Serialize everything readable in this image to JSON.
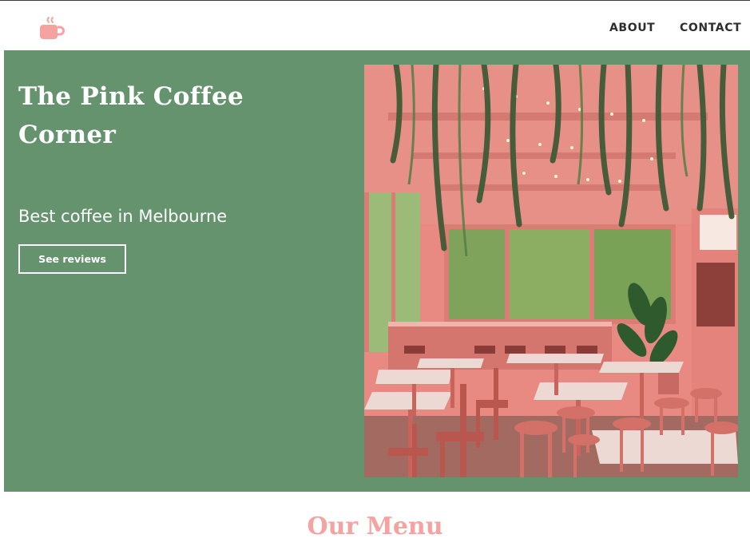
{
  "nav": {
    "logo_icon": "coffee-cup-icon",
    "about_label": "ABOUT",
    "contact_label": "CONTACT"
  },
  "hero": {
    "title": "The Pink Coffee Corner",
    "tagline": "Best coffee in Melbourne",
    "button_label": "See reviews"
  },
  "menu": {
    "heading": "Our Menu"
  },
  "colors": {
    "accent_pink": "#f4a3a0",
    "hero_green": "#64936e",
    "text_dark": "#2e2e2e",
    "white": "#ffffff"
  }
}
